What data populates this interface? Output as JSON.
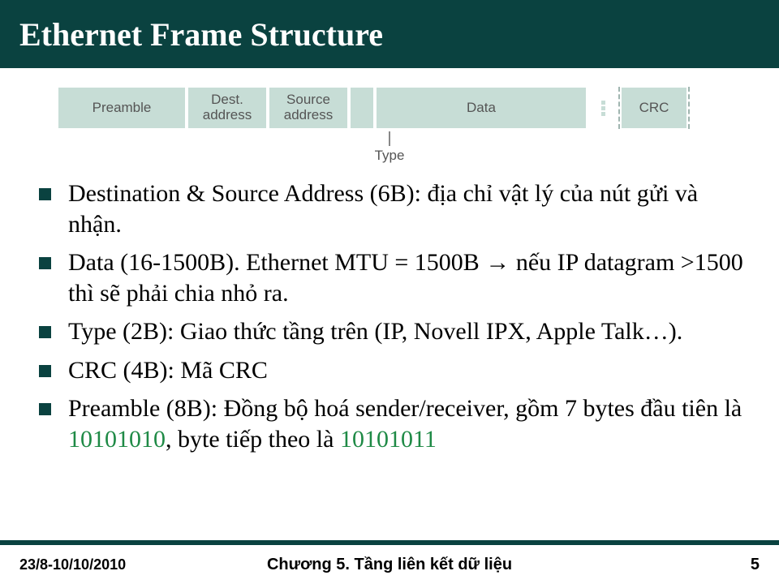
{
  "title": "Ethernet Frame Structure",
  "frame": {
    "preamble": "Preamble",
    "dest": "Dest.\naddress",
    "src": "Source\naddress",
    "type_label": "Type",
    "data": "Data",
    "crc": "CRC"
  },
  "bullets": {
    "b0": "Destination & Source Address (6B): địa chỉ vật lý của nút gửi và nhận.",
    "b1_a": "Data (16-1500B). Ethernet MTU = 1500B ",
    "b1_arrow": "→",
    "b1_b": " nếu IP datagram >1500 thì sẽ phải chia nhỏ ra.",
    "b2": "Type (2B): Giao thức tầng trên (IP, Novell IPX, Apple Talk…).",
    "b3": "CRC (4B): Mã CRC",
    "b4_a": "Preamble (8B): Đồng bộ hoá sender/receiver, gồm 7 bytes đầu tiên là ",
    "b4_num1": "10101010",
    "b4_b": ", byte tiếp theo là ",
    "b4_num2": "10101011"
  },
  "footer": {
    "date": "23/8-10/10/2010",
    "chapter": "Chương 5. Tầng liên kết dữ liệu",
    "page": "5"
  }
}
